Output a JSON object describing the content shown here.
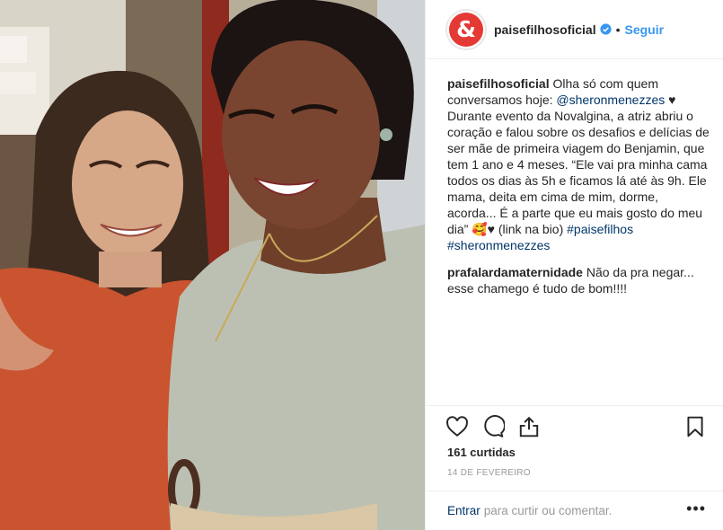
{
  "post": {
    "username": "paisefilhosoficial",
    "avatar_letter": "&",
    "dot": "•",
    "follow_label": "Seguir",
    "likes": "161 curtidas",
    "date": "14 DE FEVEREIRO"
  },
  "caption": {
    "user": "paisefilhosoficial",
    "part1": " Olha só com quem conversamos hoje: ",
    "mention": "@sheronmenezzes",
    "part2": " ♥ Durante evento da Novalgina, a atriz abriu o coração e falou sobre os desafios e delícias de ser mãe de primeira viagem do Benjamin, que tem 1 ano e 4 meses. “Ele vai pra minha cama todos os dias às 5h e ficamos lá até às 9h. Ele mama, deita em cima de mim, dorme, acorda... É a parte que eu mais gosto do meu dia” 🥰♥ (link na bio) ",
    "hashtag1": "#paisefilhos",
    "hashtag2": "#sheronmenezzes"
  },
  "comment": {
    "user": "prafalardamaternidade",
    "text": " Não da pra negar... esse chamego é tudo de bom!!!!"
  },
  "comment_box": {
    "login_link": "Entrar",
    "prompt": "para curtir ou comentar.",
    "more": "•••"
  },
  "colors": {
    "link_blue": "#3897f0",
    "dark_link": "#003569",
    "avatar_red": "#e53935"
  }
}
